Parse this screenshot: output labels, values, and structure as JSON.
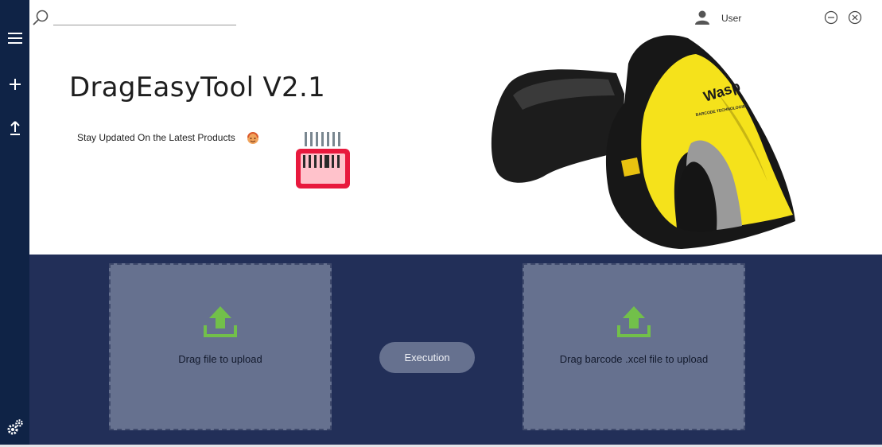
{
  "search": {
    "placeholder": "",
    "value": ""
  },
  "user": {
    "label": "User"
  },
  "window_controls": {
    "minimize_icon": "minus-circle-icon",
    "close_icon": "x-circle-icon"
  },
  "sidebar": {
    "items": [
      {
        "icon": "hamburger-menu-icon"
      },
      {
        "icon": "plus-icon"
      },
      {
        "icon": "upload-arrow-icon"
      }
    ],
    "settings_icon": "gears-icon"
  },
  "header": {
    "title": "DragEasyTool V2.1",
    "subtitle": "Stay Updated On the Latest Products"
  },
  "brand": {
    "logo_text": "Wasp",
    "tagline": "BARCODE TECHNOLOGIES"
  },
  "upload": {
    "left": {
      "label": "Drag file to upload",
      "icon": "upload-tray-icon"
    },
    "right": {
      "label": "Drag barcode .xcel file to upload",
      "icon": "upload-tray-icon"
    }
  },
  "execute_button": {
    "label": "Execution"
  },
  "colors": {
    "sidebar": "#0f2346",
    "panel": "#222f58",
    "dropzone": "#66718f",
    "upload_icon": "#72c04a",
    "scanner_yellow": "#f5e21b"
  }
}
